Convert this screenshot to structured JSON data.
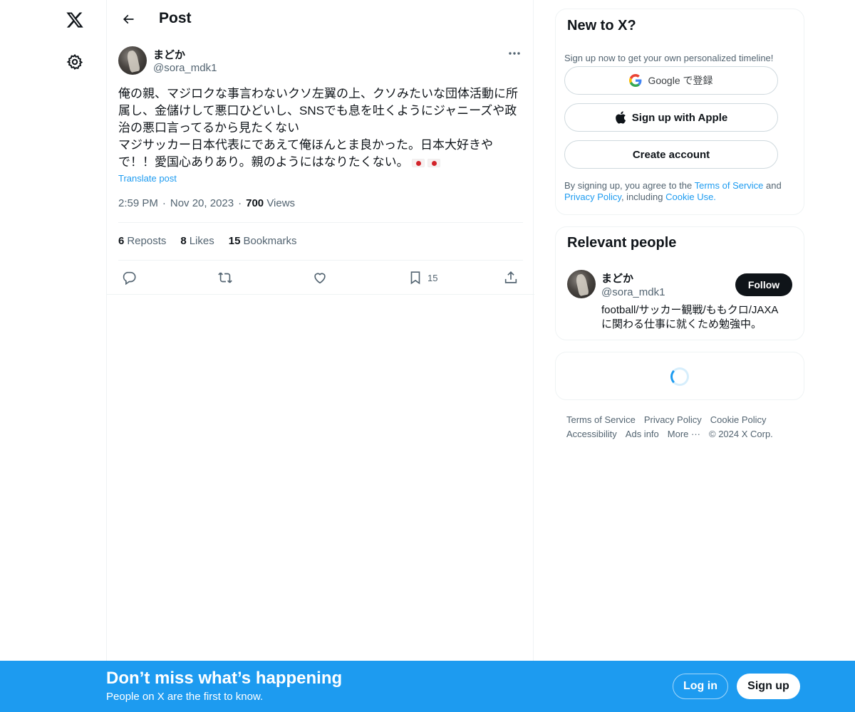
{
  "nav": {
    "logo_icon": "x-logo-icon",
    "settings_icon": "gear-icon"
  },
  "header": {
    "title": "Post"
  },
  "post": {
    "author_name": "まどか",
    "author_handle": "@sora_mdk1",
    "text_lines": [
      "俺の親、マジロクな事言わないクソ左翼の上、クソみたいな団体活動に所",
      "属し、金儲けして悪口ひどいし、SNSでも息を吐くようにジャニーズや政",
      "治の悪口言ってるから見たくない",
      "マジサッカー日本代表にであえて俺ほんとま良かった。日本大好きや",
      "で！！愛国心ありあり。親のようにはなりたくない。"
    ],
    "translate_label": "Translate post",
    "time": "2:59 PM",
    "date": "Nov 20, 2023",
    "views_count": "700",
    "views_label": "Views",
    "separator": "·",
    "reposts_count": "6",
    "reposts_label": "Reposts",
    "likes_count": "8",
    "likes_label": "Likes",
    "bookmarks_count": "15",
    "bookmarks_label": "Bookmarks",
    "bookmark_action_count": "15"
  },
  "signup_card": {
    "title": "New to X?",
    "subtitle": "Sign up now to get your own personalized timeline!",
    "google_label": "Google で登録",
    "apple_label": "Sign up with Apple",
    "create_label": "Create account",
    "legal_prefix": "By signing up, you agree to the ",
    "terms_link": "Terms of Service",
    "legal_and": " and ",
    "privacy_link": "Privacy Policy",
    "legal_including": ", including ",
    "cookie_link": "Cookie Use."
  },
  "relevant_people": {
    "title": "Relevant people",
    "name": "まどか",
    "handle": "@sora_mdk1",
    "follow_label": "Follow",
    "bio_line1": "football/サッカー観戦/ももクロ/JAXA",
    "bio_line2": "に関わる仕事に就くため勉強中。"
  },
  "footer": {
    "terms": "Terms of Service",
    "privacy": "Privacy Policy",
    "cookie": "Cookie Policy",
    "accessibility": "Accessibility",
    "ads": "Ads info",
    "more": "More ···",
    "copyright": "© 2024 X Corp."
  },
  "banner": {
    "title": "Don’t miss what’s happening",
    "subtitle": "People on X are the first to know.",
    "login_label": "Log in",
    "signup_label": "Sign up"
  },
  "colors": {
    "accent": "#1d9bf0",
    "text": "#0f1419",
    "secondary": "#536471",
    "border": "#eff3f4"
  }
}
